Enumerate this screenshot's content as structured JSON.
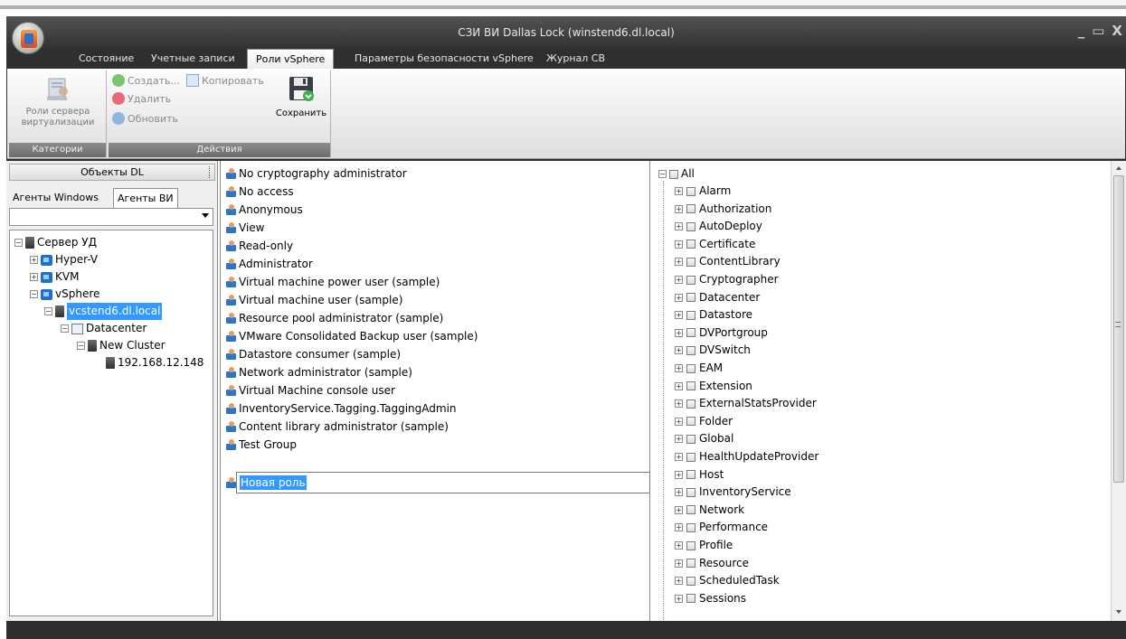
{
  "window": {
    "title": "СЗИ ВИ Dallas Lock (winstend6.dl.local)"
  },
  "ribbon_tabs": [
    {
      "label": "Состояние"
    },
    {
      "label": "Учетные записи"
    },
    {
      "label": "Роли vSphere"
    },
    {
      "label": "Параметры безопасности vSphere"
    },
    {
      "label": "Журнал СВ"
    }
  ],
  "ribbon": {
    "categories": {
      "button_label": "Роли сервера виртуализации",
      "group_label": "Категории"
    },
    "actions": {
      "create": "Создать...",
      "copy": "Копировать",
      "delete": "Удалить",
      "refresh": "Обновить",
      "save": "Сохранить",
      "group_label": "Действия"
    }
  },
  "left_panel": {
    "header": "Объекты DL",
    "tabs": [
      "Агенты Windows",
      "Агенты ВИ"
    ],
    "tree": [
      {
        "label": "Сервер УД"
      },
      {
        "label": "Hyper-V"
      },
      {
        "label": "KVM"
      },
      {
        "label": "vSphere"
      },
      {
        "label": "vcstend6.dl.local"
      },
      {
        "label": "Datacenter"
      },
      {
        "label": "New Cluster"
      },
      {
        "label": "192.168.12.148"
      }
    ]
  },
  "roles": [
    "No cryptography administrator",
    "No access",
    "Anonymous",
    "View",
    "Read-only",
    "Administrator",
    "Virtual machine power user (sample)",
    "Virtual machine user (sample)",
    "Resource pool administrator (sample)",
    "VMware Consolidated Backup user (sample)",
    "Datastore consumer (sample)",
    "Network administrator (sample)",
    "Virtual Machine console user",
    "InventoryService.Tagging.TaggingAdmin",
    "Content library administrator (sample)",
    "Test Group"
  ],
  "new_role": "Новая роль",
  "privileges": {
    "root": "All",
    "items": [
      "Alarm",
      "Authorization",
      "AutoDeploy",
      "Certificate",
      "ContentLibrary",
      "Cryptographer",
      "Datacenter",
      "Datastore",
      "DVPortgroup",
      "DVSwitch",
      "EAM",
      "Extension",
      "ExternalStatsProvider",
      "Folder",
      "Global",
      "HealthUpdateProvider",
      "Host",
      "InventoryService",
      "Network",
      "Performance",
      "Profile",
      "Resource",
      "ScheduledTask",
      "Sessions"
    ]
  }
}
